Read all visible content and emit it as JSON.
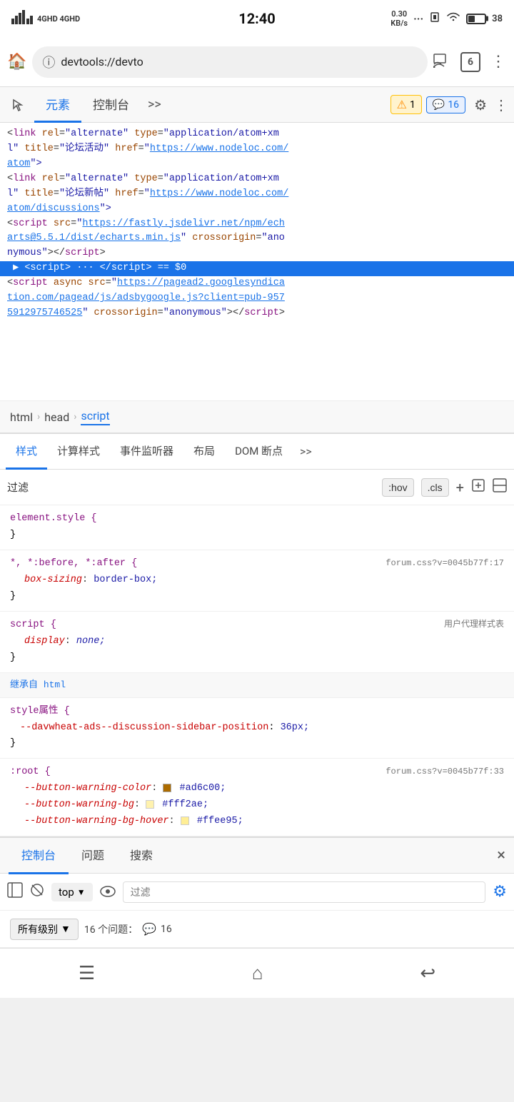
{
  "statusBar": {
    "carrier1": "4GHD",
    "carrier2": "4GHD",
    "time": "12:40",
    "speed": "0.30\nKB/s",
    "batteryPercent": "38"
  },
  "browserBar": {
    "urlText": "devtools://devto",
    "tabCount": "6"
  },
  "devtoolsBar": {
    "tabs": [
      {
        "label": "元素",
        "active": true
      },
      {
        "label": "控制台",
        "active": false
      }
    ],
    "expandLabel": ">>",
    "warningCount": "1",
    "messageCount": "16"
  },
  "htmlPanel": {
    "lines": [
      {
        "type": "normal",
        "html": "&lt;<span class='html-tag'>link</span> <span class='html-attr'>rel</span>=<span class='html-value'>\"alternate\"</span> <span class='html-attr'>type</span>=<span class='html-value'>\"application/atom+xml\"</span>"
      },
      {
        "type": "normal",
        "html": "<span class='html-attr'>l\"</span> <span class='html-attr'>title</span>=<span class='html-value'>\"论坛活动\"</span> <span class='html-attr'>href</span>=<span class='html-value'>\"<a class='html-link'>https://www.nodeloc.com/</a></span>"
      },
      {
        "type": "normal",
        "html": "<a class='html-link'>atom</a>\">"
      },
      {
        "type": "normal",
        "html": "&lt;<span class='html-tag'>link</span> <span class='html-attr'>rel</span>=<span class='html-value'>\"alternate\"</span> <span class='html-attr'>type</span>=<span class='html-value'>\"application/atom+xml\"</span>"
      },
      {
        "type": "normal",
        "html": "<span class='html-attr'>l\"</span> <span class='html-attr'>title</span>=<span class='html-value'>\"论坛新帖\"</span> <span class='html-attr'>href</span>=<span class='html-value'>\"<a class='html-link'>https://www.nodeloc.com/</a></span>"
      },
      {
        "type": "normal",
        "html": "<a class='html-link'>atom/discussions</a>\">"
      },
      {
        "type": "normal",
        "html": "&lt;<span class='html-tag'>script</span> <span class='html-attr'>src</span>=<span class='html-value'>\"<a class='html-link'>https://fastly.jsdelivr.net/npm/ech</a></span>"
      },
      {
        "type": "normal",
        "html": "<a class='html-link'>arts@5.5.1/dist/echarts.min.js</a>\" <span class='html-attr'>crossorigin</span>=<span class='html-value'>\"ano</span>"
      },
      {
        "type": "normal",
        "html": "<span class='html-value'>nymous\"</span>&gt;&lt;/<span class='html-tag'>script</span>&gt;"
      },
      {
        "type": "selected",
        "html": "▶ &lt;<span class='html-tag'>script</span>&gt; <span style='color:#aaa'>···</span> &lt;/<span class='html-tag'>script</span>&gt; <span class='eq-sign'>==</span> <span class='dollar-zero'>$0</span>"
      },
      {
        "type": "normal",
        "html": "&lt;<span class='html-tag'>script</span> <span class='html-attr'>async</span> <span class='html-attr'>src</span>=<span class='html-value'>\"<a class='html-link'>https://pagead2.googlesyndica</a></span>"
      },
      {
        "type": "normal",
        "html": "<a class='html-link'>tion.com/pagead/js/adsbygoogle.js?client=pub-957</a>"
      },
      {
        "type": "normal",
        "html": "<a class='html-link'>5912975746525</a>\" <span class='html-attr'>crossorigin</span>=<span class='html-value'>\"anonymous\"</span>&gt;&lt;/<span class='html-tag'>script</span>&gt;"
      }
    ]
  },
  "breadcrumb": {
    "items": [
      {
        "label": "html",
        "active": false
      },
      {
        "label": "head",
        "active": false
      },
      {
        "label": "script",
        "active": true
      }
    ]
  },
  "stylesTabs": {
    "tabs": [
      {
        "label": "样式",
        "active": true
      },
      {
        "label": "计算样式",
        "active": false
      },
      {
        "label": "事件监听器",
        "active": false
      },
      {
        "label": "布局",
        "active": false
      },
      {
        "label": "DOM 断点",
        "active": false
      }
    ],
    "expand": ">>"
  },
  "filterBar": {
    "placeholder": "过滤",
    "hovLabel": ":hov",
    "clsLabel": ".cls",
    "plusLabel": "+",
    "newRuleIcon": "new-rule",
    "toggleIcon": "toggle"
  },
  "stylesContent": {
    "rules": [
      {
        "selector": "element.style {",
        "properties": [],
        "closing": "}",
        "source": ""
      },
      {
        "selector": "*, *:before, *:after {",
        "properties": [
          {
            "name": "box-sizing",
            "value": "border-box;"
          }
        ],
        "closing": "}",
        "source": "forum.css?v=0045b77f:17"
      },
      {
        "selector": "script {",
        "properties": [
          {
            "name": "display",
            "value": "none;",
            "italic": true
          }
        ],
        "closing": "}",
        "source": "用户代理样式表"
      }
    ],
    "inheritedFrom": "继承自",
    "inheritedFromTag": "html",
    "styleAttr": {
      "selector": "style属性 {",
      "properties": [
        {
          "name": "--davwheat-ads--discussion-sidebar-position",
          "value": "36px;"
        }
      ],
      "closing": "}"
    },
    "rootRule": {
      "selector": ":root {",
      "source": "forum.css?v=0045b77f:33",
      "properties": [
        {
          "name": "--button-warning-color",
          "value": "#ad6c00;",
          "swatch": "#ad6c00"
        },
        {
          "name": "--button-warning-bg",
          "value": "#fff2ae;",
          "swatch": "#fff2ae"
        },
        {
          "name": "--button-warning-bg-hover",
          "value": "#ffee95;",
          "swatch": "#ffee95"
        }
      ]
    }
  },
  "consoleTabs": {
    "tabs": [
      {
        "label": "控制台",
        "active": true
      },
      {
        "label": "问题",
        "active": false
      },
      {
        "label": "搜索",
        "active": false
      }
    ],
    "closeLabel": "×"
  },
  "consoleToolbar": {
    "clearIcon": "🚫",
    "stopIcon": "⊘",
    "topLabel": "top",
    "dropdownArrow": "▼",
    "eyeIcon": "👁",
    "filterPlaceholder": "过滤",
    "settingsIcon": "⚙"
  },
  "issuesBar": {
    "levelLabel": "所有级别",
    "dropdownArrow": "▼",
    "countText": "16 个问题：",
    "messageCount": "16"
  },
  "navBar": {
    "menuIcon": "☰",
    "homeIcon": "⌂",
    "backIcon": "↩"
  }
}
